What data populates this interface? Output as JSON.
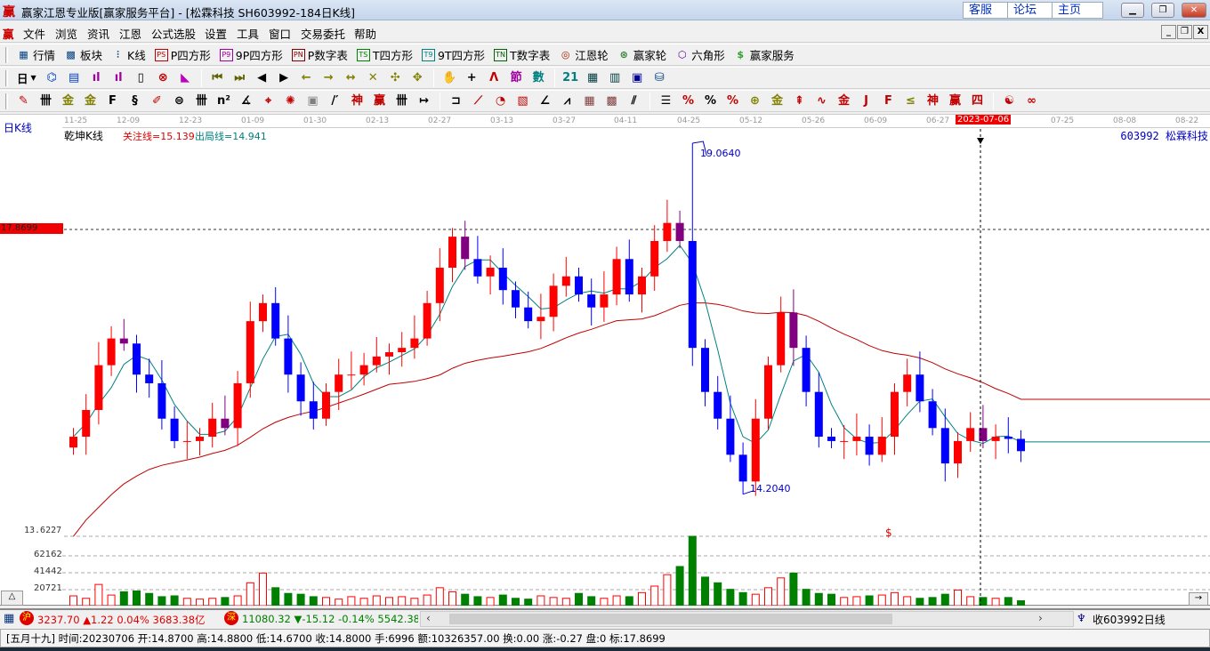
{
  "window": {
    "title": "赢家江恩专业版[赢家服务平台] - [松霖科技  SH603992-184日K线]",
    "logo": "赢",
    "links": [
      "客服",
      "论坛",
      "主页"
    ],
    "controls": [
      "minimize",
      "restore",
      "close"
    ]
  },
  "menu": {
    "logo": "赢",
    "items": [
      "文件",
      "浏览",
      "资讯",
      "江恩",
      "公式选股",
      "设置",
      "工具",
      "窗口",
      "交易委托",
      "帮助"
    ]
  },
  "toolbar1": [
    {
      "icon": "quote-table-icon",
      "glyph": "▦",
      "label": "行情"
    },
    {
      "icon": "sector-icon",
      "glyph": "▩",
      "label": "板块"
    },
    {
      "icon": "kline-icon",
      "glyph": "⫶",
      "label": "K线"
    },
    {
      "icon": "ps-icon",
      "badge": "PS",
      "label": "P四方形",
      "color": "#c00000"
    },
    {
      "icon": "p9-icon",
      "badge": "P9",
      "label": "9P四方形",
      "color": "#a000a0"
    },
    {
      "icon": "pn-icon",
      "badge": "PN",
      "label": "P数字表",
      "color": "#800000"
    },
    {
      "icon": "ts-icon",
      "badge": "TS",
      "label": "T四方形",
      "color": "#008000"
    },
    {
      "icon": "t9-icon",
      "badge": "T9",
      "label": "9T四方形",
      "color": "#008080"
    },
    {
      "icon": "tn-icon",
      "badge": "TN",
      "label": "T数字表",
      "color": "#006000"
    },
    {
      "icon": "gann-wheel-icon",
      "glyph": "◎",
      "label": "江恩轮",
      "color": "#a02000"
    },
    {
      "icon": "winner-wheel-icon",
      "glyph": "⊛",
      "label": "赢家轮",
      "color": "#308030"
    },
    {
      "icon": "hexagon-icon",
      "glyph": "⬡",
      "label": "六角形",
      "color": "#6000a0"
    },
    {
      "icon": "dollar-icon",
      "glyph": "$",
      "label": "赢家服务",
      "color": "#30a030"
    }
  ],
  "period_selector": "日",
  "toolbar2_icons": [
    [
      "chart-type-icon",
      "⌬",
      "#0040c0"
    ],
    [
      "notes-icon",
      "▤",
      "#0040c0"
    ],
    [
      "indicator3-icon",
      "ıl",
      "#a000a0"
    ],
    [
      "indicator9-icon",
      "ıl",
      "#a000a0"
    ],
    [
      "candle-icon",
      "▯",
      "#000"
    ],
    [
      "gann-icon",
      "⊗",
      "#c00000"
    ],
    [
      "volume-profile-icon",
      "◣",
      "#c000c0"
    ],
    [
      "first-icon",
      "⏮",
      "#606000"
    ],
    [
      "last-icon",
      "⏭",
      "#606000"
    ],
    [
      "prev-icon",
      "◀",
      "#000"
    ],
    [
      "next-icon",
      "▶",
      "#000"
    ],
    [
      "left-icon",
      "←",
      "#808000"
    ],
    [
      "right-icon",
      "→",
      "#808000"
    ],
    [
      "expand-icon",
      "↔",
      "#808000"
    ],
    [
      "shrink-icon",
      "✕",
      "#808000"
    ],
    [
      "zoom-in-icon",
      "✣",
      "#808000"
    ],
    [
      "zoom-out-icon",
      "✥",
      "#808000"
    ],
    [
      "hand-icon",
      "✋",
      "#000"
    ],
    [
      "crosshair-icon",
      "+",
      "#000"
    ],
    [
      "draw-line-icon",
      "ᐱ",
      "#c00000"
    ],
    [
      "section-icon",
      "節",
      "#a000a0"
    ],
    [
      "number-icon",
      "數",
      "#008080"
    ],
    [
      "calendar-icon",
      "21",
      "#008080"
    ],
    [
      "calculator-icon",
      "▦",
      "#004040"
    ],
    [
      "report-icon",
      "▥",
      "#004040"
    ],
    [
      "save-icon",
      "▣",
      "#0000a0"
    ],
    [
      "network-icon",
      "⛁",
      "#004080"
    ]
  ],
  "toolbar3_icons": [
    [
      "pen-icon",
      "✎",
      "#c00000"
    ],
    [
      "gann-grid-icon",
      "卌",
      "#000"
    ],
    [
      "gold-icon",
      "金",
      "#808000"
    ],
    [
      "gold2-icon",
      "金",
      "#808000"
    ],
    [
      "fib-icon",
      "F",
      "#000"
    ],
    [
      "spiral-icon",
      "§",
      "#000"
    ],
    [
      "brush-icon",
      "✐",
      "#c00000"
    ],
    [
      "circle-icon",
      "⊜",
      "#000"
    ],
    [
      "cycle-icon",
      "卌",
      "#000"
    ],
    [
      "n2-icon",
      "n²",
      "#000"
    ],
    [
      "angle-icon",
      "∡",
      "#000"
    ],
    [
      "target-icon",
      "⌖",
      "#c00000"
    ],
    [
      "radar-icon",
      "✺",
      "#c00000"
    ],
    [
      "square-icon",
      "▣",
      "#808080"
    ],
    [
      "lines-icon",
      "/′",
      "#000"
    ],
    [
      "shen-icon",
      "神",
      "#c00000"
    ],
    [
      "ying-icon",
      "赢",
      "#c00000"
    ],
    [
      "bars-icon",
      "卌",
      "#000"
    ],
    [
      "measure-icon",
      "↦",
      "#000"
    ],
    [
      "box-icon",
      "⊐",
      "#000"
    ],
    [
      "fan-icon",
      "⟋",
      "#c00000"
    ],
    [
      "arc-icon",
      "◔",
      "#c00000"
    ],
    [
      "square-fan-icon",
      "▧",
      "#c00000"
    ],
    [
      "angle2-icon",
      "∠",
      "#000"
    ],
    [
      "zigzag-icon",
      "⩘",
      "#000"
    ],
    [
      "grid-icon",
      "▦",
      "#804040"
    ],
    [
      "grid2-icon",
      "▩",
      "#804040"
    ],
    [
      "parallel-icon",
      "⫽",
      "#000"
    ],
    [
      "list-icon",
      "☰",
      "#000"
    ],
    [
      "pct-fan-icon",
      "%",
      "#c00000"
    ],
    [
      "percent-icon",
      "%",
      "#000"
    ],
    [
      "pct-line-icon",
      "%",
      "#c00000"
    ],
    [
      "gold-coin-icon",
      "⊕",
      "#808000"
    ],
    [
      "gold-line-icon",
      "金",
      "#808000"
    ],
    [
      "arrow-icon",
      "⇞",
      "#c00000"
    ],
    [
      "wave-icon",
      "∿",
      "#c00000"
    ],
    [
      "gold-bar-icon",
      "金",
      "#c00000"
    ],
    [
      "j-icon",
      "J",
      "#c00000"
    ],
    [
      "f-icon",
      "F",
      "#c00000"
    ],
    [
      "gold-angle-icon",
      "≤",
      "#808000"
    ],
    [
      "shen-angle-icon",
      "神",
      "#c00000"
    ],
    [
      "ying-angle-icon",
      "赢",
      "#c00000"
    ],
    [
      "four-icon",
      "四",
      "#c00000"
    ],
    [
      "taiji-icon",
      "☯",
      "#c00000"
    ],
    [
      "infinity-icon",
      "∞",
      "#c00000"
    ]
  ],
  "chart": {
    "period_label": "日K线",
    "indicator_name": "乾坤K线",
    "watch_line": "关注线=15.139",
    "exit_line": "出局线=14.941",
    "stock": "603992  松霖科技",
    "dates": [
      "11-25",
      "12-09",
      "12-23",
      "01-09",
      "01-30",
      "02-13",
      "02-27",
      "03-13",
      "03-27",
      "04-11",
      "04-25",
      "05-12",
      "05-26",
      "06-09",
      "06-27",
      "2023-07-06",
      "07-25",
      "08-08",
      "08-22"
    ],
    "cursor_date": "2023-07-06",
    "ref_price": "17.8699",
    "bottom_price": "13.6227",
    "high_label": "19.0640",
    "low_label": "14.2040",
    "signal": "$",
    "volume_ticks": [
      "62162",
      "41442",
      "20721"
    ],
    "first_open": 14.85,
    "high_index": 49,
    "high_value": 19.064,
    "low_index": 53,
    "low_value": 14.204,
    "closes": [
      15.0,
      15.37,
      15.99,
      16.36,
      16.29,
      15.86,
      15.74,
      15.25,
      14.94,
      14.94,
      15.0,
      15.25,
      15.12,
      15.74,
      16.6,
      16.85,
      16.36,
      15.86,
      15.49,
      15.25,
      15.62,
      15.86,
      15.86,
      15.99,
      16.11,
      16.17,
      16.23,
      16.36,
      16.85,
      17.34,
      17.77,
      17.46,
      17.22,
      17.34,
      17.03,
      16.79,
      16.6,
      16.66,
      17.09,
      17.22,
      16.97,
      16.79,
      16.97,
      17.46,
      16.97,
      17.22,
      17.71,
      17.96,
      17.71,
      16.23,
      15.62,
      15.25,
      14.75,
      14.38,
      15.25,
      15.99,
      16.72,
      16.23,
      15.62,
      15.0,
      14.94,
      14.94,
      15.0,
      14.75,
      15.0,
      15.62,
      15.86,
      15.49,
      15.12,
      14.63,
      14.94,
      15.12,
      14.94,
      15.0,
      14.97,
      14.8
    ],
    "volumes": [
      12000,
      9000,
      26000,
      13000,
      17000,
      18000,
      15000,
      11000,
      12000,
      9000,
      8000,
      9000,
      10000,
      12000,
      28000,
      40000,
      22000,
      15000,
      14000,
      11000,
      10000,
      8000,
      11000,
      9000,
      12000,
      10000,
      11000,
      9000,
      13000,
      22000,
      17000,
      14000,
      11000,
      10000,
      13000,
      9000,
      8000,
      12000,
      10000,
      9000,
      15000,
      11000,
      9000,
      12000,
      11000,
      16000,
      24000,
      38000,
      48000,
      85000,
      35000,
      28000,
      20000,
      16000,
      14000,
      22000,
      34000,
      40000,
      20000,
      15000,
      14000,
      10000,
      11000,
      12000,
      13000,
      16000,
      11000,
      9000,
      10000,
      14000,
      19000,
      11000,
      10000,
      9000,
      10000,
      6000
    ],
    "colors": {
      "up": "#ff0000",
      "down": "#0000ff",
      "down_alt": "#800080",
      "vol_down": "#008000",
      "ma_short": "#008080",
      "ma_long": "#c00000"
    }
  },
  "status": {
    "sh_badge": "沪",
    "sh_text": "3237.70 ▲1.22 0.04% 3683.38亿",
    "sz_badge": "深",
    "sz_text": "11080.32 ▼-15.12 -0.14% 5542.38",
    "right_text": "收603992日线",
    "info": "[五月十九] 时间:20230706 开:14.8700 高:14.8800 低:14.6700 收:14.8000 手:6996 额:10326357.00 换:0.00 涨:-0.27 盘:0 标:17.8699"
  }
}
